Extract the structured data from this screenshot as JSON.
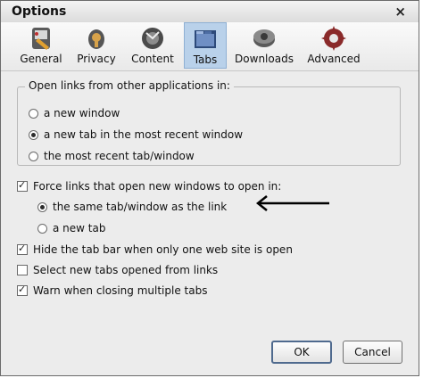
{
  "window": {
    "title": "Options",
    "close_glyph": "×"
  },
  "toolbar": {
    "items": [
      {
        "label": "General",
        "icon": "general-icon"
      },
      {
        "label": "Privacy",
        "icon": "privacy-icon"
      },
      {
        "label": "Content",
        "icon": "content-icon"
      },
      {
        "label": "Tabs",
        "icon": "tabs-icon",
        "active": true
      },
      {
        "label": "Downloads",
        "icon": "downloads-icon"
      },
      {
        "label": "Advanced",
        "icon": "advanced-icon"
      }
    ]
  },
  "open_links": {
    "legend": "Open links from other applications in:",
    "options": [
      {
        "label": "a new window",
        "selected": false
      },
      {
        "label": "a new tab in the most recent window",
        "selected": true
      },
      {
        "label": "the most recent tab/window",
        "selected": false
      }
    ]
  },
  "force_links": {
    "label": "Force links that open new windows to open in:",
    "checked": true,
    "options": [
      {
        "label": "the same tab/window as the link",
        "selected": true
      },
      {
        "label": "a new tab",
        "selected": false
      }
    ]
  },
  "checkboxes": [
    {
      "label": "Hide the tab bar when only one web site is open",
      "checked": true
    },
    {
      "label": "Select new tabs opened from links",
      "checked": false
    },
    {
      "label": "Warn when closing multiple tabs",
      "checked": true
    }
  ],
  "buttons": {
    "ok": "OK",
    "cancel": "Cancel"
  },
  "colors": {
    "active_tab": "#b9d1ea",
    "dialog_bg": "#ececec"
  }
}
